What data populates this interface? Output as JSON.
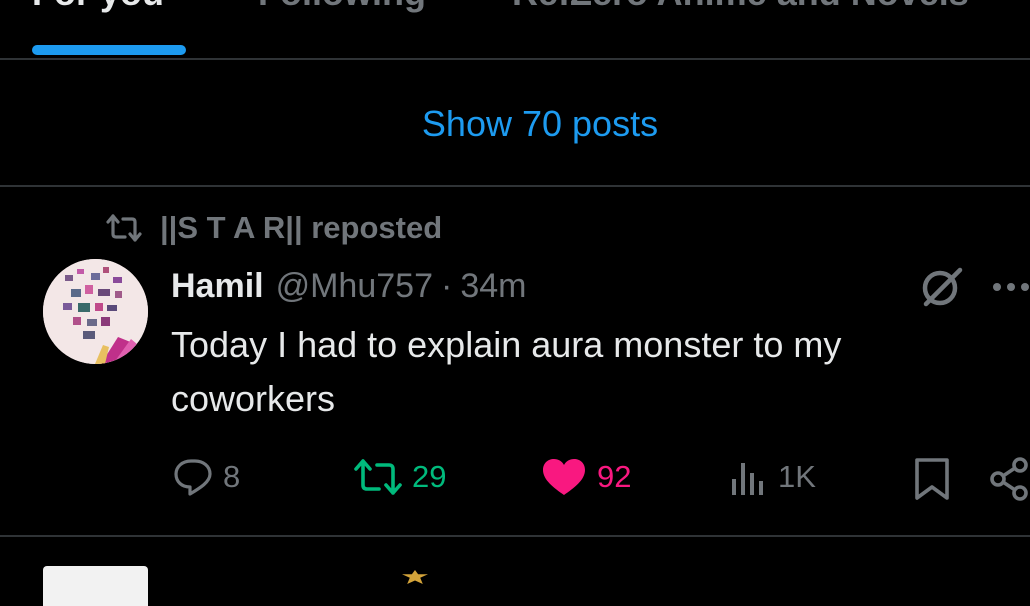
{
  "tabs": [
    {
      "label": "For you",
      "active": true
    },
    {
      "label": "Following",
      "active": false
    },
    {
      "label": "Re:Zero Anime and Novels",
      "active": false
    }
  ],
  "show_posts": "Show 70 posts",
  "post": {
    "repost_by": "||S T A R|| reposted",
    "author_name": "Hamil",
    "handle": "@Mhu757",
    "separator": "·",
    "time": "34m",
    "text": "Today I had to explain aura monster to my coworkers",
    "replies": "8",
    "reposts": "29",
    "likes": "92",
    "views": "1K"
  },
  "icons": {
    "repost": "repost-icon",
    "reply": "reply-icon",
    "like": "heart-icon",
    "views": "views-icon",
    "bookmark": "bookmark-icon",
    "share": "share-icon",
    "grok": "grok-icon",
    "more": "more-icon"
  },
  "colors": {
    "background": "#000000",
    "accent": "#1d9bf0",
    "text": "#e7e9ea",
    "muted": "#71767b",
    "retweet": "#00ba7c",
    "like": "#f91880",
    "divider": "#2f3336"
  }
}
